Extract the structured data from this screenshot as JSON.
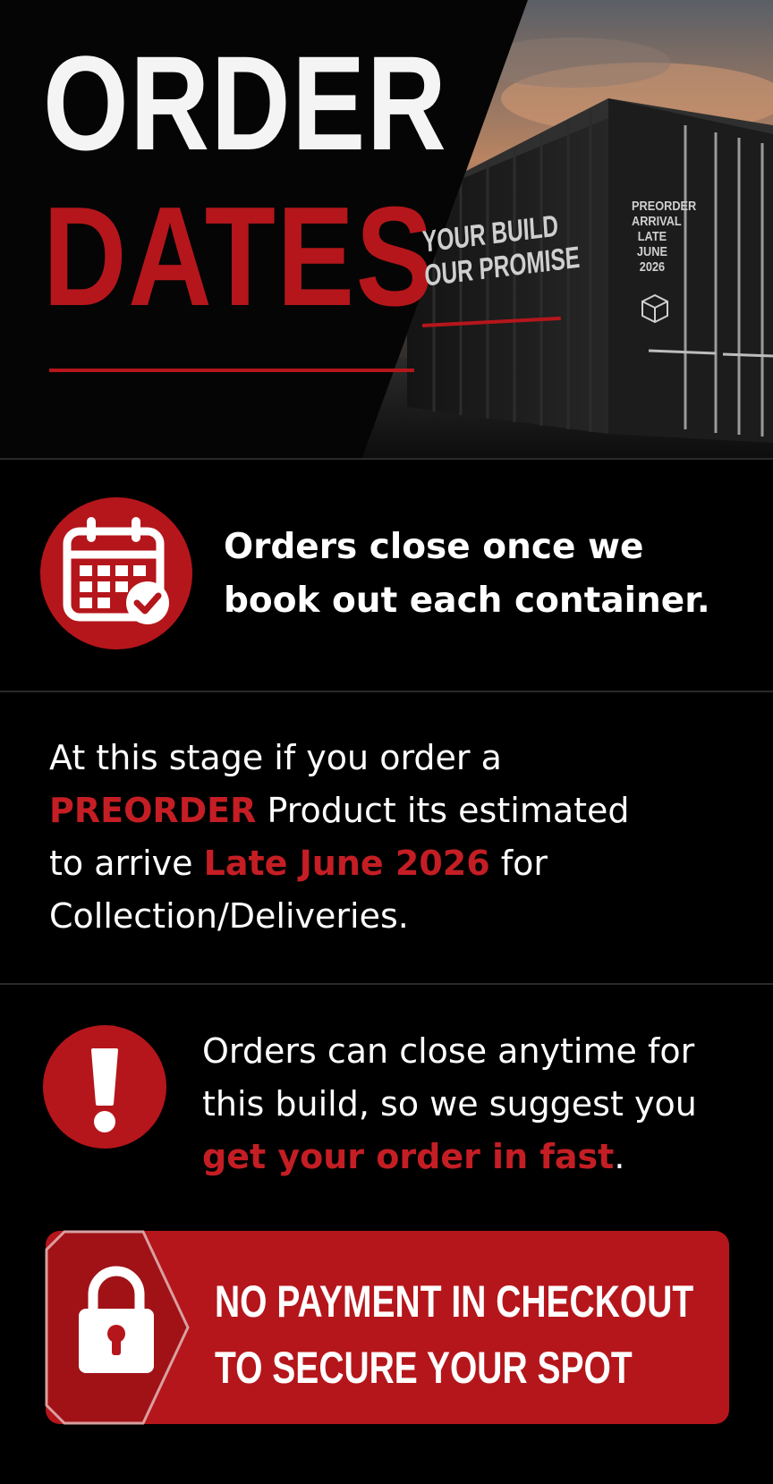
{
  "hero": {
    "title_line1": "ORDER",
    "title_line2": "DATES",
    "container_slogan_line1": "YOUR BUILD",
    "container_slogan_line2": "OUR PROMISE",
    "container_door_label": [
      "PREORDER",
      "ARRIVAL",
      "LATE JUNE",
      "2026"
    ]
  },
  "notice1": {
    "icon": "calendar-check-icon",
    "line1": "Orders close once we",
    "line2": "book out each container."
  },
  "notice2": {
    "line1": "At this stage if you order a",
    "highlight1": "PREORDER",
    "line2_rest": " Product its estimated",
    "line3_pre": "to arrive ",
    "highlight2": "Late June 2026",
    "line3_post": " for",
    "line4": "Collection/Deliveries."
  },
  "notice3": {
    "icon": "exclamation-icon",
    "line1": "Orders can close anytime for",
    "line2": "this build, so we suggest you",
    "highlight": "get your order in fast",
    "trailing": "."
  },
  "cta": {
    "icon": "padlock-icon",
    "line1": "NO PAYMENT IN CHECKOUT",
    "line2": "TO SECURE YOUR SPOT"
  },
  "colors": {
    "accent": "#b5161b",
    "background": "#000000",
    "text": "#ffffff"
  }
}
